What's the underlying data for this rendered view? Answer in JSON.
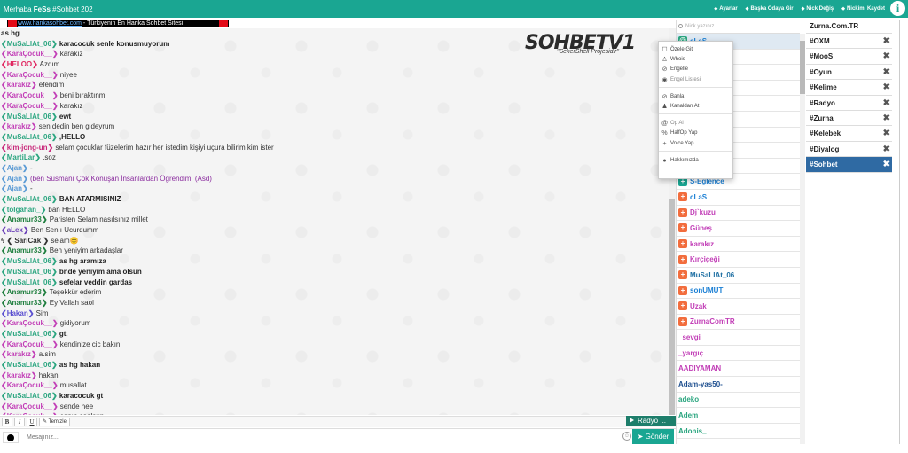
{
  "topbar": {
    "greeting": "Merhaba ",
    "user": "FeSs",
    "room_info": " #Sohbet 202",
    "actions": [
      {
        "label": "Ayarlar",
        "icon": "gear-icon"
      },
      {
        "label": "Başka Odaya Gir",
        "icon": "users-icon"
      },
      {
        "label": "Nick Değiş",
        "icon": "reply-icon"
      },
      {
        "label": "Nickimi Kaydet",
        "icon": "user-plus-icon"
      }
    ],
    "info_label": "i"
  },
  "ticker": {
    "url": "www.hankasohbet.com",
    "text": " - Türkiyenin En Harika Sohbet Sitesi "
  },
  "logo": {
    "main": "SOHBETV1",
    "sub": "\"SekerShell Projesidir\""
  },
  "messages": [
    {
      "nick": "",
      "text": "as hg",
      "color": "#2aa57f",
      "bold": true
    },
    {
      "nick": "❮MuSaLlAt_06❯",
      "text": " karacocuk senle konusmuyorum",
      "color": "#2aa57f",
      "bold": true
    },
    {
      "nick": "❮KaraÇocuk__❯",
      "text": " karakız",
      "color": "#c23fb7",
      "bold": false
    },
    {
      "nick": "❮HELOO❯",
      "text": " Azdım",
      "color": "#e0245e",
      "bold": false
    },
    {
      "nick": "❮KaraÇocuk__❯",
      "text": " niyee",
      "color": "#c23fb7",
      "bold": false
    },
    {
      "nick": "❮karakız❯",
      "text": " efendim",
      "color": "#c23fb7",
      "bold": false
    },
    {
      "nick": "❮KaraÇocuk__❯",
      "text": " beni bıraktınmı",
      "color": "#c23fb7",
      "bold": false
    },
    {
      "nick": "❮KaraÇocuk__❯",
      "text": " karakız",
      "color": "#c23fb7",
      "bold": false
    },
    {
      "nick": "❮MuSaLlAt_06❯",
      "text": " ewt",
      "color": "#2aa57f",
      "bold": true
    },
    {
      "nick": "❮karakız❯",
      "text": " sen dedin ben gideyrum",
      "color": "#c23fb7",
      "bold": false
    },
    {
      "nick": "❮MuSaLlAt_06❯",
      "text": " ,HELLO",
      "color": "#2aa57f",
      "bold": true
    },
    {
      "nick": "❮kim-jong-un❯",
      "text": " selam çocuklar füzelerim hazır her istedim kişiyi uçura bilirim kim ister",
      "color": "#c8287a",
      "bold": false
    },
    {
      "nick": "❮MartiLar❯",
      "text": " .soz",
      "color": "#2aa57f",
      "bold": false
    },
    {
      "nick": "❮Ajan❯",
      "text": " -",
      "color": "#5b9bd5",
      "bold": false
    },
    {
      "nick": "❮Ajan❯",
      "text": " (ben Susmanı Çok Konuşan İnsanlardan Öğrendim. (Asd)",
      "color": "#5b9bd5",
      "bold": false,
      "purple": true
    },
    {
      "nick": "❮Ajan❯",
      "text": " -",
      "color": "#5b9bd5",
      "bold": false
    },
    {
      "nick": "❮MuSaLlAt_06❯",
      "text": " BAN ATARMISINIZ",
      "color": "#2aa57f",
      "bold": true
    },
    {
      "nick": "❮tolgahan_❯",
      "text": " ban HELLO",
      "color": "#2aa57f",
      "bold": false
    },
    {
      "nick": "❮Anamur33❯",
      "text": " Paristen Selam nasılsınız millet",
      "color": "#1e7e3e",
      "bold": false
    },
    {
      "nick": "❮aLex❯",
      "text": " Ben Sen ı Ucurdumm",
      "color": "#6a3fb7",
      "bold": false
    },
    {
      "nick": "ϟ ❮ SarıCak ❯",
      "text": "  selam😊",
      "color": "#333333",
      "bold": false
    },
    {
      "nick": "❮Anamur33❯",
      "text": " Ben yeniyim arkadaşlar",
      "color": "#1e7e3e",
      "bold": false
    },
    {
      "nick": "❮MuSaLlAt_06❯",
      "text": " as hg aramıza",
      "color": "#2aa57f",
      "bold": true
    },
    {
      "nick": "❮MuSaLlAt_06❯",
      "text": " bnde yeniyim ama olsun",
      "color": "#2aa57f",
      "bold": true
    },
    {
      "nick": "❮MuSaLlAt_06❯",
      "text": " sefelar veddin gardas",
      "color": "#2aa57f",
      "bold": true
    },
    {
      "nick": "❮Anamur33❯",
      "text": " Teşekkür ederim",
      "color": "#1e7e3e",
      "bold": false
    },
    {
      "nick": "❮Anamur33❯",
      "text": " Ey Vallah saol",
      "color": "#1e7e3e",
      "bold": false
    },
    {
      "nick": "❮Hakan❯",
      "text": " Sim",
      "color": "#5a4fd0",
      "bold": false
    },
    {
      "nick": "❮KaraÇocuk__❯",
      "text": " gidiyorum",
      "color": "#c23fb7",
      "bold": false
    },
    {
      "nick": "❮MuSaLlAt_06❯",
      "text": " gt,",
      "color": "#2aa57f",
      "bold": true
    },
    {
      "nick": "❮KaraÇocuk__❯",
      "text": " kendinize cic bakın",
      "color": "#c23fb7",
      "bold": false
    },
    {
      "nick": "❮karakız❯",
      "text": " a.sim",
      "color": "#c23fb7",
      "bold": false
    },
    {
      "nick": "❮MuSaLlAt_06❯",
      "text": " as hg hakan",
      "color": "#2aa57f",
      "bold": true
    },
    {
      "nick": "❮karakız❯",
      "text": " hakan",
      "color": "#c23fb7",
      "bold": false
    },
    {
      "nick": "❮KaraÇocuk__❯",
      "text": " musallat",
      "color": "#c23fb7",
      "bold": false
    },
    {
      "nick": "❮MuSaLlAt_06❯",
      "text": " karacocuk gt",
      "color": "#2aa57f",
      "bold": true
    },
    {
      "nick": "❮KaraÇocuk__❯",
      "text": " sende hee",
      "color": "#c23fb7",
      "bold": false
    },
    {
      "nick": "❮KaraÇocuk__❯",
      "text": " canın saolsun",
      "color": "#c23fb7",
      "bold": false
    }
  ],
  "format": {
    "bold": "B",
    "italic": "I",
    "underline": "U",
    "clear": "Temizle"
  },
  "radio": {
    "label": "Radyo ..."
  },
  "input": {
    "placeholder": "Mesajınız...",
    "send": "Gönder",
    "smiley": "☺"
  },
  "user_search": {
    "placeholder": "Nick yazınız"
  },
  "users": [
    {
      "name": "cLaS",
      "color": "#1a7fd4",
      "badge": "@",
      "badge_color": "#2aa57f",
      "selected": true
    },
    {
      "name": "",
      "color": "#333",
      "badge": "",
      "badge_color": ""
    },
    {
      "name": "",
      "color": "#333",
      "badge": "",
      "badge_color": ""
    },
    {
      "name": "",
      "color": "#333",
      "badge": "",
      "badge_color": ""
    },
    {
      "name": "",
      "color": "#333",
      "badge": "",
      "badge_color": ""
    },
    {
      "name": "",
      "color": "#333",
      "badge": "",
      "badge_color": ""
    },
    {
      "name": "",
      "color": "#333",
      "badge": "",
      "badge_color": ""
    },
    {
      "name": "",
      "color": "#333",
      "badge": "",
      "badge_color": ""
    },
    {
      "name": "",
      "color": "#333",
      "badge": "",
      "badge_color": ""
    },
    {
      "name": "S-Eglence",
      "color": "#1a7fd4",
      "badge": "+",
      "badge_color": "#1aa692"
    },
    {
      "name": "cLaS",
      "color": "#1a7fd4",
      "badge": "+",
      "badge_color": "#f26d3d"
    },
    {
      "name": "Dj`kuzu",
      "color": "#c23fb7",
      "badge": "+",
      "badge_color": "#f26d3d"
    },
    {
      "name": "Güneş",
      "color": "#c23fb7",
      "badge": "+",
      "badge_color": "#f26d3d"
    },
    {
      "name": "karakız",
      "color": "#c23fb7",
      "badge": "+",
      "badge_color": "#f26d3d"
    },
    {
      "name": "Kırçiçeği",
      "color": "#c23fb7",
      "badge": "+",
      "badge_color": "#f26d3d"
    },
    {
      "name": "MuSaLlAt_06",
      "color": "#1e6fa3",
      "badge": "+",
      "badge_color": "#f26d3d"
    },
    {
      "name": "sonUMUT",
      "color": "#1a7fd4",
      "badge": "+",
      "badge_color": "#f26d3d"
    },
    {
      "name": "Uzak",
      "color": "#c23fb7",
      "badge": "+",
      "badge_color": "#f26d3d"
    },
    {
      "name": "ZurnaComTR",
      "color": "#c23fb7",
      "badge": "+",
      "badge_color": "#f26d3d"
    },
    {
      "name": "_sevgi___",
      "color": "#c23fb7",
      "badge": "",
      "badge_color": ""
    },
    {
      "name": "_yargıç",
      "color": "#c23fb7",
      "badge": "",
      "badge_color": ""
    },
    {
      "name": "AADIYAMAN",
      "color": "#c23fb7",
      "badge": "",
      "badge_color": ""
    },
    {
      "name": "Adam-yas50-",
      "color": "#1e4f8f",
      "badge": "",
      "badge_color": ""
    },
    {
      "name": "adeko",
      "color": "#2aa57f",
      "badge": "",
      "badge_color": ""
    },
    {
      "name": "Adem",
      "color": "#2aa57f",
      "badge": "",
      "badge_color": ""
    },
    {
      "name": "Adonis_",
      "color": "#2aa57f",
      "badge": "",
      "badge_color": ""
    }
  ],
  "context_menu": {
    "groups": [
      [
        {
          "label": "Özele Git",
          "icon": "chat-icon",
          "glyph": "☐"
        },
        {
          "label": "Whois",
          "icon": "user-icon",
          "glyph": "♙"
        },
        {
          "label": "Engelle",
          "icon": "eye-slash-icon",
          "glyph": "⊘"
        },
        {
          "label": "Engel Listesi",
          "icon": "eye-icon",
          "glyph": "◉",
          "muted": true
        }
      ],
      [
        {
          "label": "Banla",
          "icon": "ban-icon",
          "glyph": "⊘"
        },
        {
          "label": "Kanaldan At",
          "icon": "kick-icon",
          "glyph": "♟"
        }
      ],
      [
        {
          "label": "Op Al",
          "icon": "at-icon",
          "glyph": "@",
          "muted": true
        },
        {
          "label": "HalfOp Yap",
          "icon": "percent-icon",
          "glyph": "%"
        },
        {
          "label": "Voice Yap",
          "icon": "plus-icon",
          "glyph": "+"
        }
      ],
      [
        {
          "label": "Hakkımızda",
          "icon": "info-icon",
          "glyph": "●"
        }
      ]
    ]
  },
  "rooms": {
    "header": "Zurna.Com.TR",
    "list": [
      {
        "name": "#OXM",
        "active": false
      },
      {
        "name": "#MooS",
        "active": false
      },
      {
        "name": "#Oyun",
        "active": false
      },
      {
        "name": "#Kelime",
        "active": false
      },
      {
        "name": "#Radyo",
        "active": false
      },
      {
        "name": "#Zurna",
        "active": false
      },
      {
        "name": "#Kelebek",
        "active": false
      },
      {
        "name": "#Diyalog",
        "active": false
      },
      {
        "name": "#Sohbet",
        "active": true
      }
    ],
    "close_glyph": "✖"
  }
}
